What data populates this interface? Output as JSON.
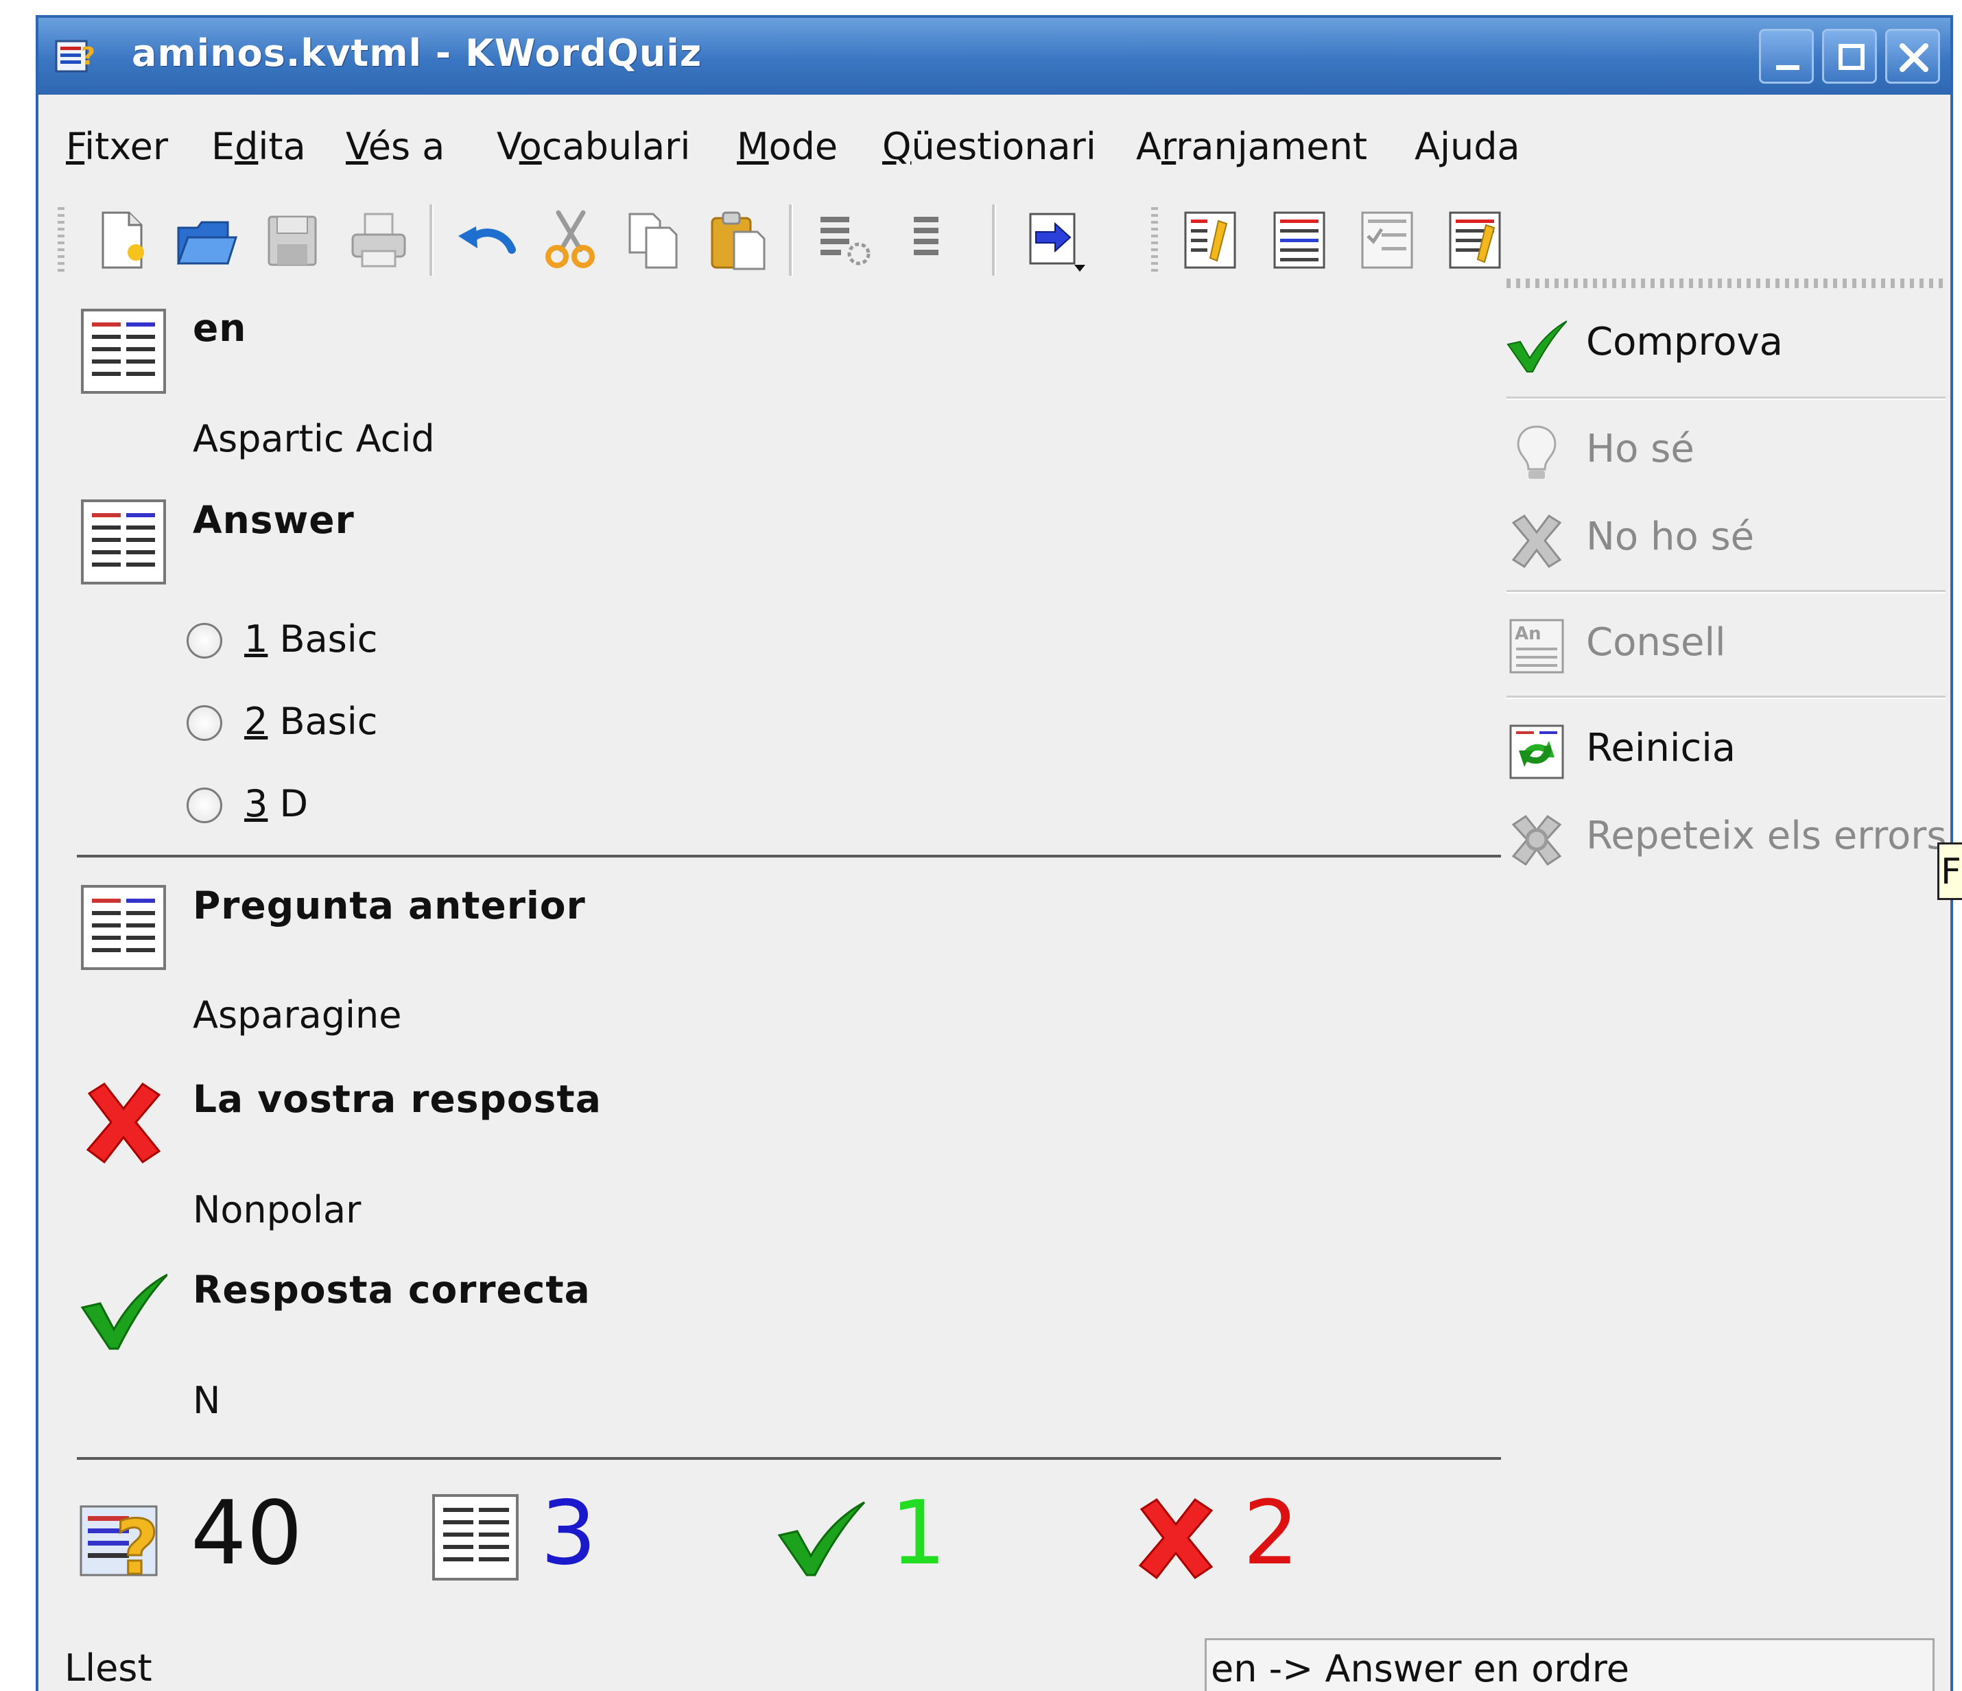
{
  "window": {
    "title": "aminos.kvtml - KWordQuiz",
    "buttons": [
      "minimize",
      "maximize",
      "close"
    ]
  },
  "menu": [
    {
      "pre": "",
      "mn": "F",
      "post": "itxer"
    },
    {
      "pre": "E",
      "mn": "d",
      "post": "ita"
    },
    {
      "pre": "",
      "mn": "V",
      "post": "és a"
    },
    {
      "pre": "V",
      "mn": "o",
      "post": "cabulari"
    },
    {
      "pre": "",
      "mn": "M",
      "post": "ode"
    },
    {
      "pre": "",
      "mn": "Q",
      "post": "üestionari"
    },
    {
      "pre": "A",
      "mn": "r",
      "post": "ranjament"
    },
    {
      "pre": "A",
      "mn": "j",
      "post": "uda"
    }
  ],
  "toolbar_icons": [
    "new-file-icon",
    "open-folder-icon",
    "save-icon",
    "print-icon",
    "undo-icon",
    "cut-icon",
    "copy-icon",
    "paste-icon",
    "insert-row-icon",
    "delete-row-icon",
    "mode-icon",
    "editor-icon",
    "qa-icon",
    "multiple-choice-icon",
    "flashcard-icon"
  ],
  "quiz": {
    "question_language": "en",
    "question": "Aspartic Acid",
    "answer_language": "Answer",
    "options": [
      {
        "num": "1",
        "text": " Basic"
      },
      {
        "num": "2",
        "text": " Basic"
      },
      {
        "num": "3",
        "text": " D"
      }
    ],
    "previous_label": "Pregunta anterior",
    "previous_value": "Asparagine",
    "your_answer_label": "La vostra resposta",
    "your_answer_value": "Nonpolar",
    "correct_label": "Resposta correcta",
    "correct_value": "N"
  },
  "actions": {
    "check": "Comprova",
    "know": "Ho sé",
    "dont_know": "No ho sé",
    "hint": "Consell",
    "restart": "Reinicia",
    "repeat_errors": "Repeteix els errors"
  },
  "stats": {
    "total": "40",
    "remaining": "3",
    "correct": "1",
    "errors": "2"
  },
  "colors": {
    "remaining": "#1a1acc",
    "correct": "#22dd22",
    "errors": "#dd1111",
    "titlebar": "#3a76c2"
  },
  "status": {
    "left": "Llest",
    "right": "en -> Answer en ordre",
    "tooltip_fragment": "F"
  }
}
